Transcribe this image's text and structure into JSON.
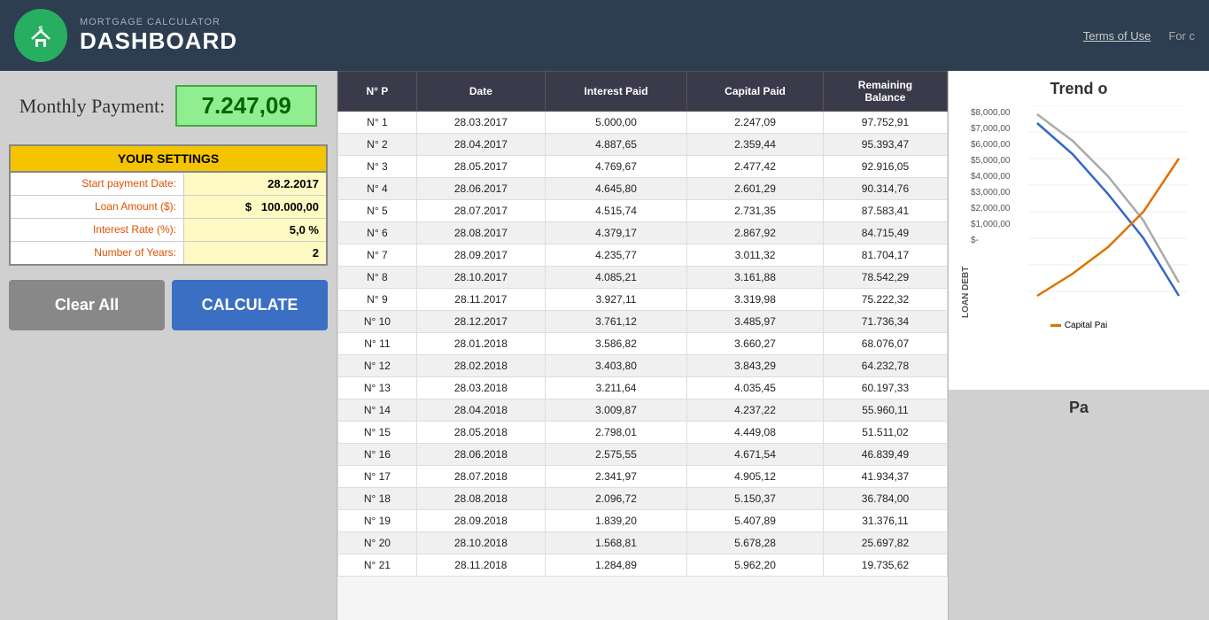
{
  "header": {
    "subtitle": "MORTGAGE CALCULATOR",
    "title": "DASHBOARD",
    "terms_label": "Terms of Use",
    "for_text": "For c"
  },
  "monthly": {
    "label": "Monthly Payment:",
    "value": "7.247,09"
  },
  "settings": {
    "title": "YOUR SETTINGS",
    "rows": [
      {
        "label": "Start payment Date:",
        "value": "28.2.2017"
      },
      {
        "label": "Loan Amount ($):",
        "value": "$    100.000,00"
      },
      {
        "label": "Interest Rate (%):",
        "value": "5,0 %"
      },
      {
        "label": "Number of Years:",
        "value": "2"
      }
    ]
  },
  "buttons": {
    "clear": "Clear All",
    "calculate": "CALCULATE"
  },
  "table": {
    "headers": [
      "N° P",
      "Date",
      "Interest Paid",
      "Capital Paid",
      "Remaining Balance"
    ],
    "rows": [
      [
        "N° 1",
        "28.03.2017",
        "5.000,00",
        "2.247,09",
        "97.752,91"
      ],
      [
        "N° 2",
        "28.04.2017",
        "4.887,65",
        "2.359,44",
        "95.393,47"
      ],
      [
        "N° 3",
        "28.05.2017",
        "4.769,67",
        "2.477,42",
        "92.916,05"
      ],
      [
        "N° 4",
        "28.06.2017",
        "4.645,80",
        "2.601,29",
        "90.314,76"
      ],
      [
        "N° 5",
        "28.07.2017",
        "4.515,74",
        "2.731,35",
        "87.583,41"
      ],
      [
        "N° 6",
        "28.08.2017",
        "4.379,17",
        "2.867,92",
        "84.715,49"
      ],
      [
        "N° 7",
        "28.09.2017",
        "4.235,77",
        "3.011,32",
        "81.704,17"
      ],
      [
        "N° 8",
        "28.10.2017",
        "4.085,21",
        "3.161,88",
        "78.542,29"
      ],
      [
        "N° 9",
        "28.11.2017",
        "3.927,11",
        "3.319,98",
        "75.222,32"
      ],
      [
        "N° 10",
        "28.12.2017",
        "3.761,12",
        "3.485,97",
        "71.736,34"
      ],
      [
        "N° 11",
        "28.01.2018",
        "3.586,82",
        "3.660,27",
        "68.076,07"
      ],
      [
        "N° 12",
        "28.02.2018",
        "3.403,80",
        "3.843,29",
        "64.232,78"
      ],
      [
        "N° 13",
        "28.03.2018",
        "3.211,64",
        "4.035,45",
        "60.197,33"
      ],
      [
        "N° 14",
        "28.04.2018",
        "3.009,87",
        "4.237,22",
        "55.960,11"
      ],
      [
        "N° 15",
        "28.05.2018",
        "2.798,01",
        "4.449,08",
        "51.511,02"
      ],
      [
        "N° 16",
        "28.06.2018",
        "2.575,55",
        "4.671,54",
        "46.839,49"
      ],
      [
        "N° 17",
        "28.07.2018",
        "2.341,97",
        "4.905,12",
        "41.934,37"
      ],
      [
        "N° 18",
        "28.08.2018",
        "2.096,72",
        "5.150,37",
        "36.784,00"
      ],
      [
        "N° 19",
        "28.09.2018",
        "1.839,20",
        "5.407,89",
        "31.376,11"
      ],
      [
        "N° 20",
        "28.10.2018",
        "1.568,81",
        "5.678,28",
        "25.697,82"
      ],
      [
        "N° 21",
        "28.11.2018",
        "1.284,89",
        "5.962,20",
        "19.735,62"
      ]
    ]
  },
  "chart": {
    "top_title": "Trend o",
    "bottom_title": "Pa",
    "y_label": "LOAN DEBT",
    "y_ticks": [
      "$8,000,00",
      "$7,000,00",
      "$6,000,00",
      "$5,000,00",
      "$4,000,00",
      "$3,000,00",
      "$2,000,00",
      "$1,000,00",
      "$-"
    ],
    "legend": [
      {
        "label": "Capital Pai",
        "color": "#e07000"
      }
    ],
    "colors": {
      "interest_line": "#888888",
      "debt_line": "#3366cc",
      "capital_line": "#e07000"
    }
  }
}
